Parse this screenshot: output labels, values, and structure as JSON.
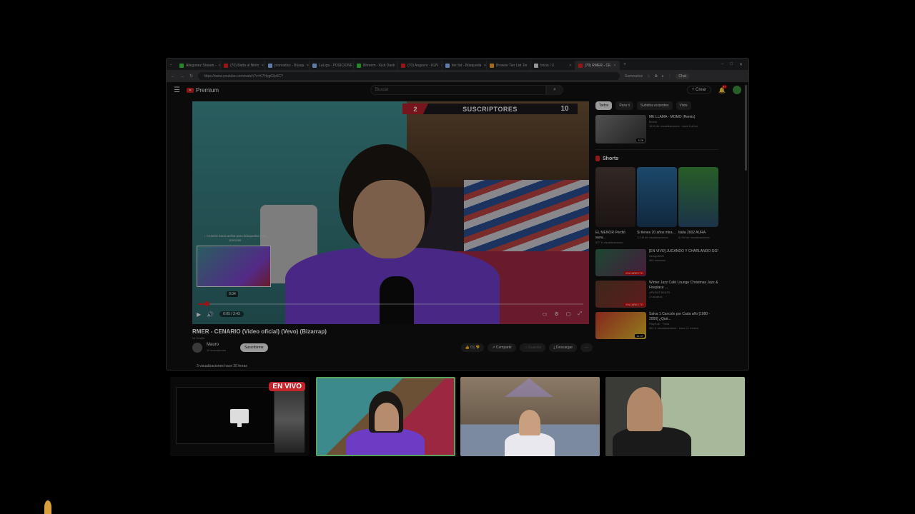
{
  "browser": {
    "tabs": [
      {
        "label": "Allegonez Stream -",
        "color": "#37c837"
      },
      {
        "label": "(70) Bada al Nitrio",
        "color": "#e02020"
      },
      {
        "label": "pronostics - Búsqu",
        "color": "#8ab4f8"
      },
      {
        "label": "LaLiga - POSICIONE",
        "color": "#8ab4f8"
      },
      {
        "label": "Bhreem - Kick Dash",
        "color": "#37c837"
      },
      {
        "label": "(70) Anguvro - KUV",
        "color": "#e02020"
      },
      {
        "label": "tier list - Búsqueda",
        "color": "#8ab4f8"
      },
      {
        "label": "Browse Tier List Ter",
        "color": "#f0a020"
      },
      {
        "label": "Inicio / X",
        "color": "#dddddd"
      },
      {
        "label": "(70) RMER - CE",
        "color": "#e02020"
      }
    ],
    "url": "https://www.youtube.com/watch?v=K7Hyg62p6CY",
    "summarize": "Summarize",
    "chat": "Chat"
  },
  "yt": {
    "logo": "Premium",
    "search_placeholder": "Buscar",
    "create": "Crear",
    "notif_badge": "9+"
  },
  "player": {
    "overlay_left": "2",
    "overlay_label": "SUSCRIPTORES",
    "overlay_right": "10",
    "hint": "↑ Arrastra hacia arriba para búsquedas más precisas",
    "preview_time": "0:04",
    "time": "0:05 / 3:43",
    "progress": 0.02
  },
  "video": {
    "title": "RMER - CENARIO (Video oficial) (Vevo) (Bizarrap)",
    "subtitle": "Mi Desfile",
    "channel": "Mauro",
    "subs": "10 suscriptores",
    "subscribe": "Suscribirme",
    "likes": "0",
    "share": "Compartir",
    "clip": "Guardar",
    "download": "Descargar",
    "views": "3 visualizaciones  hace 20 horas"
  },
  "sidebar": {
    "chips": [
      "Todos",
      "Para ti",
      "Subidos recientes",
      "Visto"
    ],
    "rec1": {
      "title": "ME LLAMA - MOMO (Remix)",
      "channel": "Momo",
      "meta": "18 M de visualizaciones · hace 6 años",
      "duration": "3:28"
    },
    "shorts_title": "Shorts",
    "shorts": [
      {
        "title": "EL MENOR Perdió aura...",
        "views": "637 K visualizaciones"
      },
      {
        "title": "Si tienes 20 años mira ...",
        "views": "1,2 M de visualizaciones"
      },
      {
        "title": "Italia 2002 AURA",
        "views": "4,9 M de visualizaciones"
      }
    ],
    "live": [
      {
        "title": "[EN VIVO] JUGANDO Y CHARLANDO GG!",
        "channel": "Newgull600",
        "meta": "362 usuarios",
        "badge": "EN DIRECTO"
      },
      {
        "title": "Winter Jazz Café Lounge Christmas Jazz & Fireplace ...",
        "channel": "APARAT BEATS",
        "meta": "2 usuarios",
        "badge": "EN DIRECTO"
      },
      {
        "title": "Salva 1 Canción por Cada año [1980 - 2000] ¿Qué...",
        "channel": "PlaySub · Trivia",
        "meta": "961 K visualizaciones · hace 11 meses",
        "duration": "11:37"
      }
    ]
  },
  "cams": {
    "live_label": "EN VIVO"
  }
}
